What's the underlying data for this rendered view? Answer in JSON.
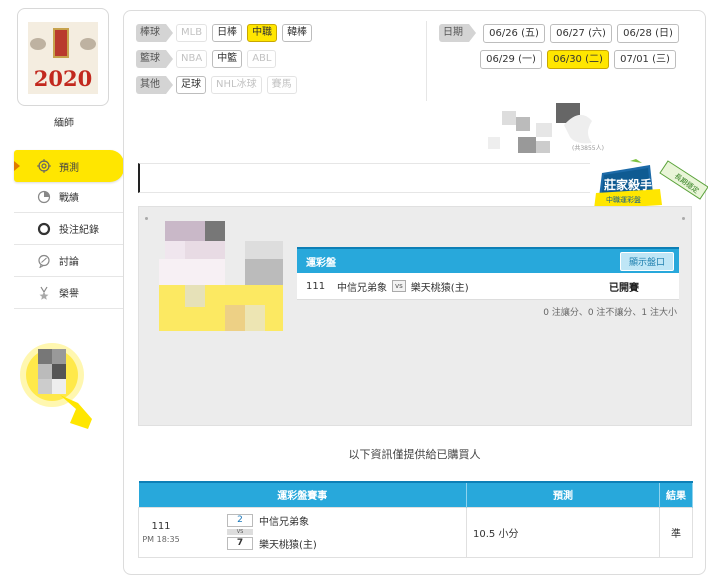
{
  "sidebar": {
    "avatar_year": "2020",
    "username": "緬師",
    "nav": [
      {
        "label": "預測",
        "icon": "target-icon",
        "active": true
      },
      {
        "label": "戰績",
        "icon": "chart-icon",
        "active": false
      },
      {
        "label": "投注紀錄",
        "icon": "record-icon",
        "active": false
      },
      {
        "label": "討論",
        "icon": "discussion-icon",
        "active": false
      },
      {
        "label": "榮譽",
        "icon": "medal-icon",
        "active": false
      }
    ]
  },
  "filters": {
    "rows": [
      {
        "category": "棒球",
        "items": [
          {
            "label": "MLB",
            "state": "disabled"
          },
          {
            "label": "日棒",
            "state": "normal"
          },
          {
            "label": "中職",
            "state": "active"
          },
          {
            "label": "韓棒",
            "state": "normal"
          }
        ]
      },
      {
        "category": "籃球",
        "items": [
          {
            "label": "NBA",
            "state": "disabled"
          },
          {
            "label": "中籃",
            "state": "normal"
          },
          {
            "label": "ABL",
            "state": "disabled"
          }
        ]
      },
      {
        "category": "其他",
        "items": [
          {
            "label": "足球",
            "state": "normal"
          },
          {
            "label": "NHL冰球",
            "state": "disabled"
          },
          {
            "label": "賽馬",
            "state": "disabled"
          }
        ]
      }
    ]
  },
  "dates": {
    "label": "日期",
    "row1": [
      {
        "label": "06/26 (五)",
        "active": false
      },
      {
        "label": "06/27 (六)",
        "active": false
      },
      {
        "label": "06/28 (日)",
        "active": false
      }
    ],
    "row2": [
      {
        "label": "06/29 (一)",
        "active": false
      },
      {
        "label": "06/30 (二)",
        "active": true
      },
      {
        "label": "07/01 (三)",
        "active": false
      }
    ]
  },
  "popularity": "(共3855人)",
  "badge": {
    "title": "莊家殺手",
    "subtitle": "中職運彩盤",
    "ribbon": "長期穩定"
  },
  "odds": {
    "title": "運彩盤",
    "show_button": "顯示盤口",
    "game_no": "111",
    "away_team": "中信兄弟象",
    "vs": "vs",
    "home_team": "樂天桃猿(主)",
    "status": "已開賽",
    "summary": "0 注讓分、0 注不讓分、1 注大小"
  },
  "notice": "以下資訊僅提供給已購買人",
  "results": {
    "headers": {
      "match": "運彩盤賽事",
      "prediction": "預測",
      "result": "結果"
    },
    "rows": [
      {
        "game_no": "111",
        "time": "PM 18:35",
        "away_score": "2",
        "away_team": "中信兄弟象",
        "vs": "VS",
        "home_score": "7",
        "home_team": "樂天桃猿(主)",
        "prediction": "10.5 小分",
        "result": "準"
      }
    ]
  },
  "colors": {
    "accent_yellow": "#ffe600",
    "header_blue": "#28a8db",
    "result_green": "#2e8b3a"
  }
}
